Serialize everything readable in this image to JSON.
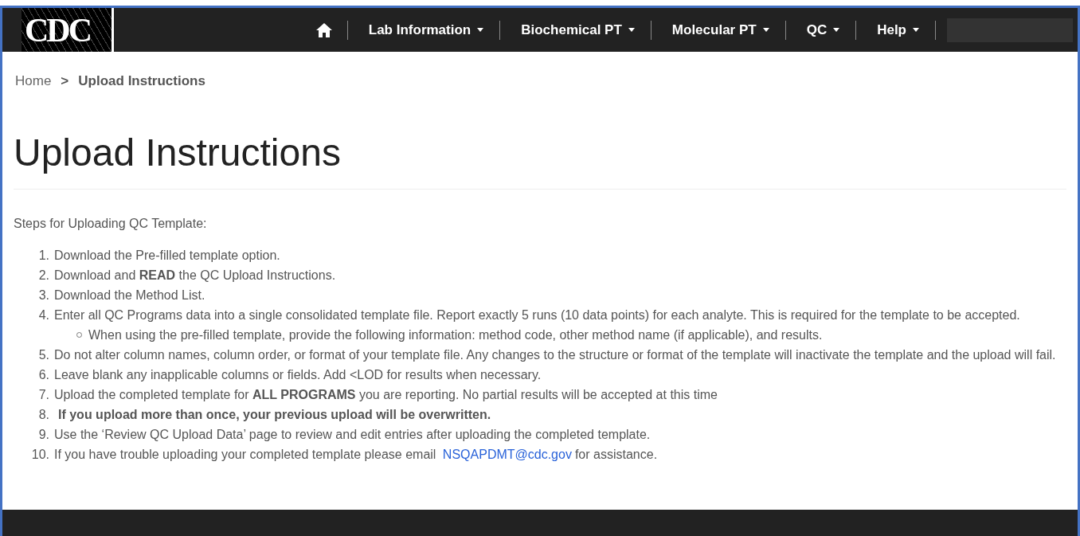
{
  "header": {
    "logo": "CDC",
    "nav": [
      {
        "label": "Lab Information"
      },
      {
        "label": "Biochemical PT"
      },
      {
        "label": "Molecular PT"
      },
      {
        "label": "QC"
      },
      {
        "label": "Help"
      }
    ]
  },
  "breadcrumb": [
    {
      "label": "Home",
      "current": false
    },
    {
      "label": "Upload Instructions",
      "current": true
    }
  ],
  "breadcrumb_separator": ">",
  "title": "Upload Instructions",
  "intro": "Steps for Uploading QC Template:",
  "steps": [
    {
      "number": "1.",
      "text": "Download the Pre-filled template option.",
      "bold": false
    },
    {
      "number": "2.",
      "text": "Download and **READ** the QC Upload Instructions.",
      "bold": false
    },
    {
      "number": "3.",
      "text": "Download the Method List.",
      "bold": false
    },
    {
      "number": "4.",
      "text": "Enter all QC Programs data into a single consolidated template file. Report exactly 5 runs (10 data points) for each analyte. This is required for the template to be accepted.",
      "bold": false,
      "children": [
        {
          "text": "When using the pre-filled template, provide the following information: method code, other method name (if applicable), and results."
        }
      ]
    },
    {
      "number": "5.",
      "text": "Do not alter column names, column order, or format of your template file. Any changes to the structure or format of the template will inactivate the template and the upload will fail.",
      "bold": false
    },
    {
      "number": "6.",
      "text": "Leave blank any inapplicable columns or fields. Add <LOD for results when necessary.",
      "bold": false
    },
    {
      "number": "7.",
      "text": "Upload the completed template for **ALL PROGRAMS** you are reporting. No partial results will be accepted at this time",
      "bold": false
    },
    {
      "number": "8.",
      "text": "If you upload more than once, your previous upload will be overwritten.",
      "bold": true
    },
    {
      "number": "9.",
      "text": "Use the ‘Review QC Upload Data’ page to review and edit entries after uploading the completed template.",
      "bold": false
    },
    {
      "number": "10.",
      "text": "If you have trouble uploading your completed template please email",
      "bold": false,
      "link": "NSQAPDMT@cdc.gov",
      "after": "for assistance."
    }
  ]
}
